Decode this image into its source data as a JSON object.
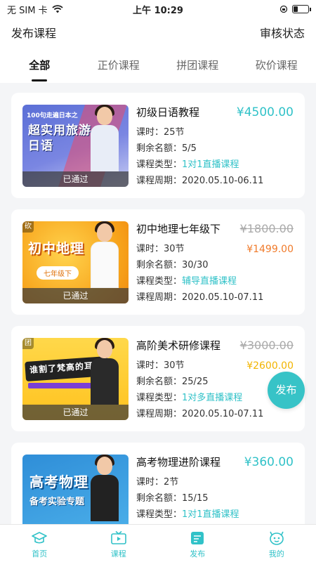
{
  "status_bar": {
    "carrier": "无 SIM 卡",
    "time": "上午 10:29",
    "battery_level": 0.3
  },
  "header": {
    "title": "发布课程",
    "right_label": "审核状态"
  },
  "tabs": [
    {
      "label": "全部",
      "active": true
    },
    {
      "label": "正价课程",
      "active": false
    },
    {
      "label": "拼团课程",
      "active": false
    },
    {
      "label": "砍价课程",
      "active": false
    }
  ],
  "courses": [
    {
      "title": "初级日语教程",
      "price": "¥4500.00",
      "hours_label": "课时：",
      "hours": "25节",
      "slots_label": "剩余名额：",
      "slots": "5/5",
      "type_label": "课程类型：",
      "type": "1对1直播课程",
      "period_label": "课程周期：",
      "period": "2020.05.10-06.11",
      "status": "已通过",
      "thumb_sub": "100句走遍日本之",
      "thumb_headline": "超实用旅游日语"
    },
    {
      "title": "初中地理七年级下",
      "price_old": "¥1800.00",
      "price_new": "¥1499.00",
      "price_color": "#f07a2a",
      "tag": "砍",
      "hours_label": "课时：",
      "hours": "30节",
      "slots_label": "剩余名额：",
      "slots": "30/30",
      "type_label": "课程类型：",
      "type": "辅导直播课程",
      "period_label": "课程周期：",
      "period": "2020.05.10-07.11",
      "status": "已通过",
      "thumb_headline": "初中地理",
      "thumb_chip": "七年级下"
    },
    {
      "title": "高阶美术研修课程",
      "price_old": "¥3000.00",
      "price_new": "¥2600.00",
      "price_color": "#f2b400",
      "tag": "团",
      "hours_label": "课时：",
      "hours": "30节",
      "slots_label": "剩余名额：",
      "slots": "25/25",
      "type_label": "课程类型：",
      "type": "1对多直播课程",
      "period_label": "课程周期：",
      "period": "2020.05.10-07.11",
      "status": "已通过",
      "thumb_headline": "谁割了梵高的耳朵"
    },
    {
      "title": "高考物理进阶课程",
      "price": "¥360.00",
      "hours_label": "课时：",
      "hours": "2节",
      "slots_label": "剩余名额：",
      "slots": "15/15",
      "type_label": "课程类型：",
      "type": "1对1直播课程",
      "thumb_headline": "高考物理",
      "thumb_sub2": "备考实验专题"
    }
  ],
  "fab": {
    "label": "发布"
  },
  "bottom_nav": [
    {
      "label": "首页",
      "icon": "graduation-cap-icon"
    },
    {
      "label": "课程",
      "icon": "tv-icon"
    },
    {
      "label": "发布",
      "icon": "edit-icon"
    },
    {
      "label": "我的",
      "icon": "profile-icon"
    }
  ],
  "colors": {
    "accent": "#31c2c8",
    "fab": "#37c3c7",
    "bargain_price": "#f07a2a",
    "group_price": "#f2b400"
  }
}
